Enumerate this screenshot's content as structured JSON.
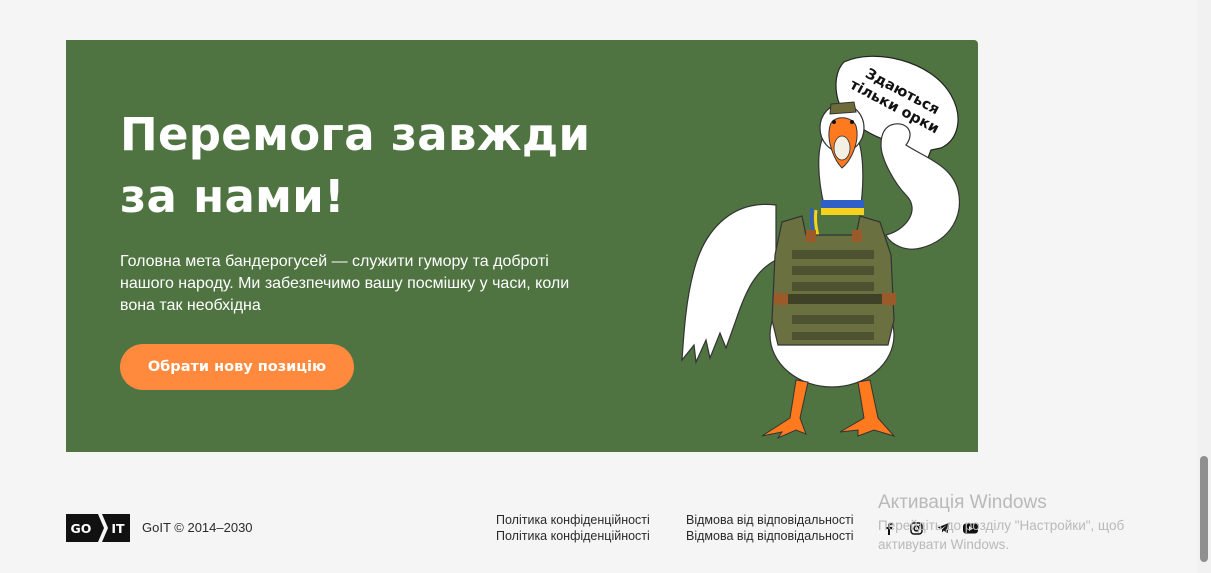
{
  "hero": {
    "title": "Перемога завжди за нами!",
    "description": "Головна мета бандерогусей — служити гумору та доброті нашого народу. Ми забезпечимо вашу посмішку у часи, коли вона так необхідна",
    "button_label": "Обрати нову позицію",
    "speech_bubble_line1": "Здаються",
    "speech_bubble_line2": "тільки орки",
    "background_color": "#4f7442",
    "button_color": "#ff8a3d"
  },
  "footer": {
    "logo_left": "GO",
    "logo_right": "IT",
    "copyright": "GoIT © 2014–2030",
    "links_column_1": [
      "Політика конфіденційності",
      "Політика конфіденційності"
    ],
    "links_column_2": [
      "Відмова від відповідальності",
      "Відмова від відповідальності"
    ],
    "social_icons": [
      "facebook-icon",
      "instagram-icon",
      "telegram-icon",
      "youtube-icon"
    ]
  },
  "watermark": {
    "title": "Активація Windows",
    "text": "Перейдіть до розділу \"Настройки\", щоб активувати Windows."
  }
}
